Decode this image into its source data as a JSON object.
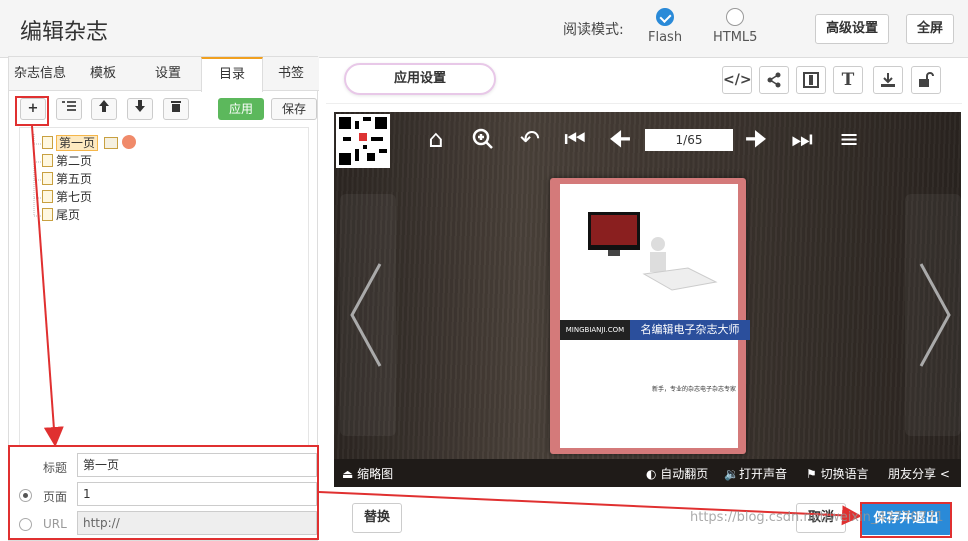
{
  "header": {
    "title": "编辑杂志",
    "read_mode_label": "阅读模式:",
    "modes": [
      {
        "label": "Flash",
        "selected": true
      },
      {
        "label": "HTML5",
        "selected": false
      }
    ],
    "advanced_label": "高级设置",
    "fullscreen_label": "全屏"
  },
  "left": {
    "tabs": [
      {
        "label": "杂志信息"
      },
      {
        "label": "模板"
      },
      {
        "label": "设置"
      },
      {
        "label": "目录",
        "active": true
      },
      {
        "label": "书签"
      }
    ],
    "toolbar": {
      "add": "+",
      "apply": "应用",
      "save": "保存"
    },
    "tree": [
      "第一页",
      "第二页",
      "第五页",
      "第七页",
      "尾页"
    ],
    "form": {
      "title_label": "标题",
      "title_value": "第一页",
      "page_label": "页面",
      "page_value": "1",
      "url_label": "URL",
      "url_value": "http://"
    }
  },
  "right": {
    "settings_label": "应用设置",
    "icons": [
      "code-icon",
      "share-icon",
      "layout-icon",
      "text-icon",
      "download-icon",
      "unlock-icon"
    ],
    "viewer": {
      "page_counter": "1/65",
      "book": {
        "brand_left": "MINGBIANJI.COM",
        "brand_right": "名编辑电子杂志大师",
        "tagline": "新手，专业的杂志电子杂志专家"
      },
      "bottom": {
        "thumbnails": "缩略图",
        "autoflip": "自动翻页",
        "sound": "打开声音",
        "language": "切换语言",
        "share": "朋友分享"
      }
    },
    "replace_label": "替换",
    "cancel_label": "取消",
    "save_exit_label": "保存并退出"
  },
  "watermark": "https://blog.csdn.net/weixin_43770771",
  "colors": {
    "accent": "#2a8ad8",
    "apply_green": "#5cb85c",
    "annotation_red": "#e03030"
  }
}
